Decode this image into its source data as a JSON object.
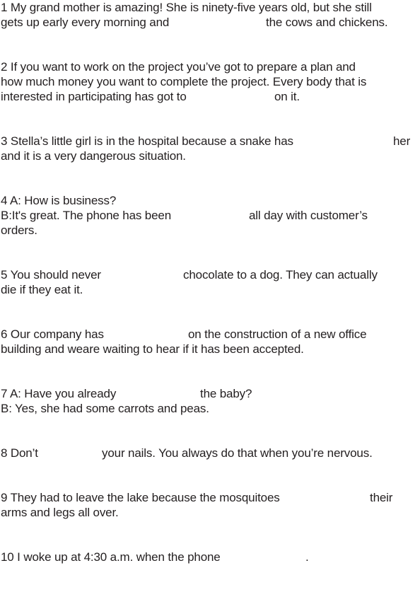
{
  "questions": [
    {
      "number": "1",
      "line1_before": "1 My grand mother is amazing! She is ninety-five years old, but she still",
      "line2_before": "gets up early every morning and",
      "line2_after": "the cows and chickens."
    },
    {
      "number": "2",
      "line1": "2 If you want to work on the project you’ve got to prepare a plan and",
      "line2": "how much money you want to complete the project. Every body that is",
      "line3_before": "interested in participating has got to",
      "line3_after": "on it."
    },
    {
      "number": "3",
      "line1_before": "3 Stella’s little girl is in the hospital because a snake has",
      "line1_after": "her",
      "line2": "and it is a very dangerous situation."
    },
    {
      "number": "4",
      "line1": "4 A: How is business?",
      "line2_before": "B:It's great. The phone has been",
      "line2_after": "all day with customer’s",
      "line3": "orders."
    },
    {
      "number": "5",
      "line1_before": "5 You should never",
      "line1_after": "chocolate to a dog. They can actually",
      "line2": "die if they eat it."
    },
    {
      "number": "6",
      "line1_before": "6 Our company has",
      "line1_after": "on the construction of a new office",
      "line2": "building and weare waiting to hear if it has been accepted."
    },
    {
      "number": "7",
      "line1_before": "7 A: Have you already",
      "line1_after": "the baby?",
      "line2": "B: Yes, she had some carrots and peas."
    },
    {
      "number": "8",
      "line1_before": "8 Don’t",
      "line1_after": "your nails. You always do that when you’re nervous."
    },
    {
      "number": "9",
      "line1_before": "9 They had to leave the lake because the mosquitoes",
      "line1_after": "their",
      "line2": "arms and legs all over."
    },
    {
      "number": "10",
      "line1_before": "10 I woke up at 4:30 a.m. when the phone",
      "line1_after": "."
    }
  ]
}
